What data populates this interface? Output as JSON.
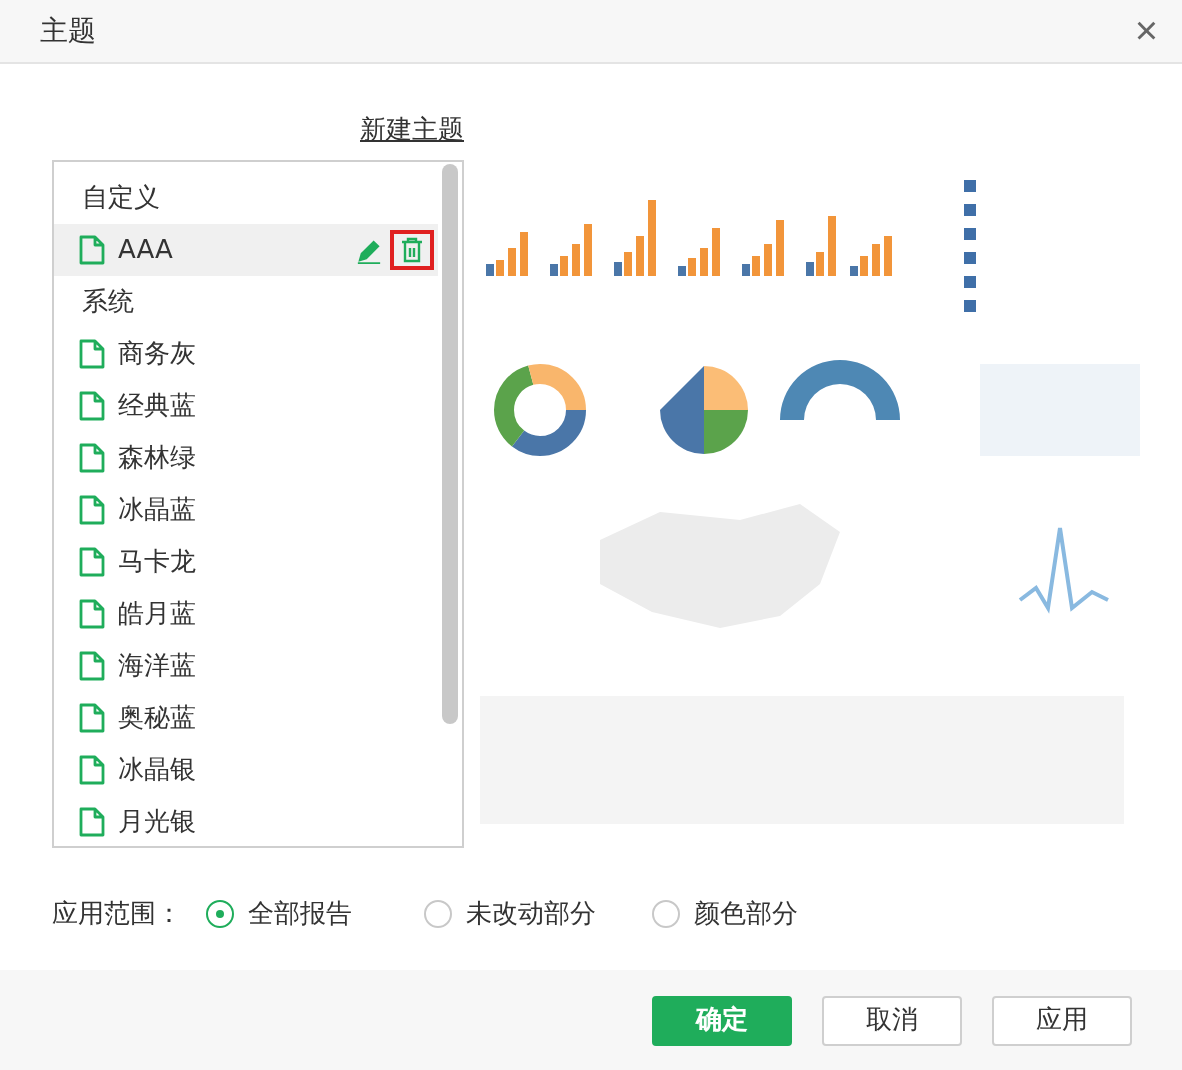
{
  "window": {
    "title": "主题",
    "close": "×"
  },
  "new_theme_link": "新建主题",
  "theme_groups": [
    {
      "label": "自定义",
      "items": [
        {
          "name": "AAA",
          "selected": true,
          "delete_highlighted": true
        }
      ]
    },
    {
      "label": "系统",
      "items": [
        {
          "name": "商务灰",
          "selected": false
        },
        {
          "name": "经典蓝",
          "selected": false
        },
        {
          "name": "森林绿",
          "selected": false
        },
        {
          "name": "冰晶蓝",
          "selected": false
        },
        {
          "name": "马卡龙",
          "selected": false
        },
        {
          "name": "皓月蓝",
          "selected": false
        },
        {
          "name": "海洋蓝",
          "selected": false
        },
        {
          "name": "奥秘蓝",
          "selected": false
        },
        {
          "name": "冰晶银",
          "selected": false
        },
        {
          "name": "月光银",
          "selected": false
        }
      ]
    }
  ],
  "scope": {
    "label": "应用范围：",
    "options": [
      {
        "label": "全部报告",
        "selected": true
      },
      {
        "label": "未改动部分",
        "selected": false
      },
      {
        "label": "颜色部分",
        "selected": false
      }
    ]
  },
  "buttons": [
    {
      "label": "确定",
      "kind": "primary"
    },
    {
      "label": "取消",
      "kind": "default"
    },
    {
      "label": "应用",
      "kind": "default"
    }
  ]
}
